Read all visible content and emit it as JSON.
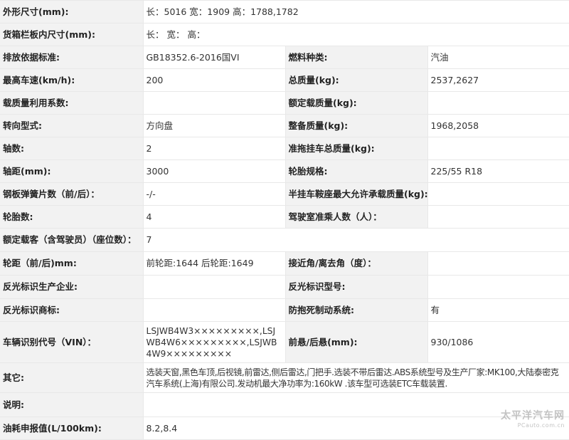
{
  "rows": [
    {
      "label": "外形尺寸(mm):",
      "value": "长：5016 宽：1909 高：1788,1782"
    },
    {
      "label": "货箱栏板内尺寸(mm):",
      "value": "长：  宽：  高："
    },
    {
      "label": "排放依据标准:",
      "value": "GB18352.6-2016国VI",
      "label2": "燃料种类:",
      "value2": "汽油"
    },
    {
      "label": "最高车速(km/h):",
      "value": "200",
      "label2": "总质量(kg):",
      "value2": "2537,2627"
    },
    {
      "label": "载质量利用系数:",
      "value": "",
      "label2": "额定载质量(kg):",
      "value2": ""
    },
    {
      "label": "转向型式:",
      "value": "方向盘",
      "label2": "整备质量(kg):",
      "value2": "1968,2058"
    },
    {
      "label": "轴数:",
      "value": "2",
      "label2": "准拖挂车总质量(kg):",
      "value2": ""
    },
    {
      "label": "轴距(mm):",
      "value": "3000",
      "label2": "轮胎规格:",
      "value2": "225/55 R18"
    },
    {
      "label": "钢板弹簧片数（前/后）：",
      "value": "-/-",
      "label2": "半挂车鞍座最大允许承载质量(kg):",
      "value2": ""
    },
    {
      "label": "轮胎数:",
      "value": "4",
      "label2": "驾驶室准乘人数（人）：",
      "value2": ""
    },
    {
      "label": "额定载客（含驾驶员）（座位数）：",
      "value": "7"
    },
    {
      "label": "轮距（前/后)mm:",
      "value": "前轮距:1644 后轮距:1649",
      "label2": "接近角/离去角（度）：",
      "value2": ""
    },
    {
      "label": "反光标识生产企业:",
      "value": "",
      "label2": "反光标识型号:",
      "value2": ""
    },
    {
      "label": "反光标识商标:",
      "value": "",
      "label2": "防抱死制动系统:",
      "value2": "有"
    },
    {
      "label": "车辆识别代号（VIN）：",
      "value": "LSJWB4W3×××××××××,LSJWB4W6×××××××××,LSJWB4W9×××××××××",
      "label2": "前悬/后悬(mm):",
      "value2": "930/1086"
    },
    {
      "label": "其它:",
      "value": "选装天窗,黑色车顶,后视镜,前雷达,侧后雷达,门把手.选装不带后雷达.ABS系统型号及生产厂家:MK100,大陆泰密克汽车系统(上海)有限公司.发动机最大净功率为:160kW .该车型可选装ETC车载装置."
    },
    {
      "label": "说明:",
      "value": ""
    },
    {
      "label": "油耗申报值(L/100km):",
      "value": "8.2,8.4"
    }
  ],
  "watermark": {
    "main": "太平洋汽车网",
    "sub": "PCauto.com.cn"
  }
}
